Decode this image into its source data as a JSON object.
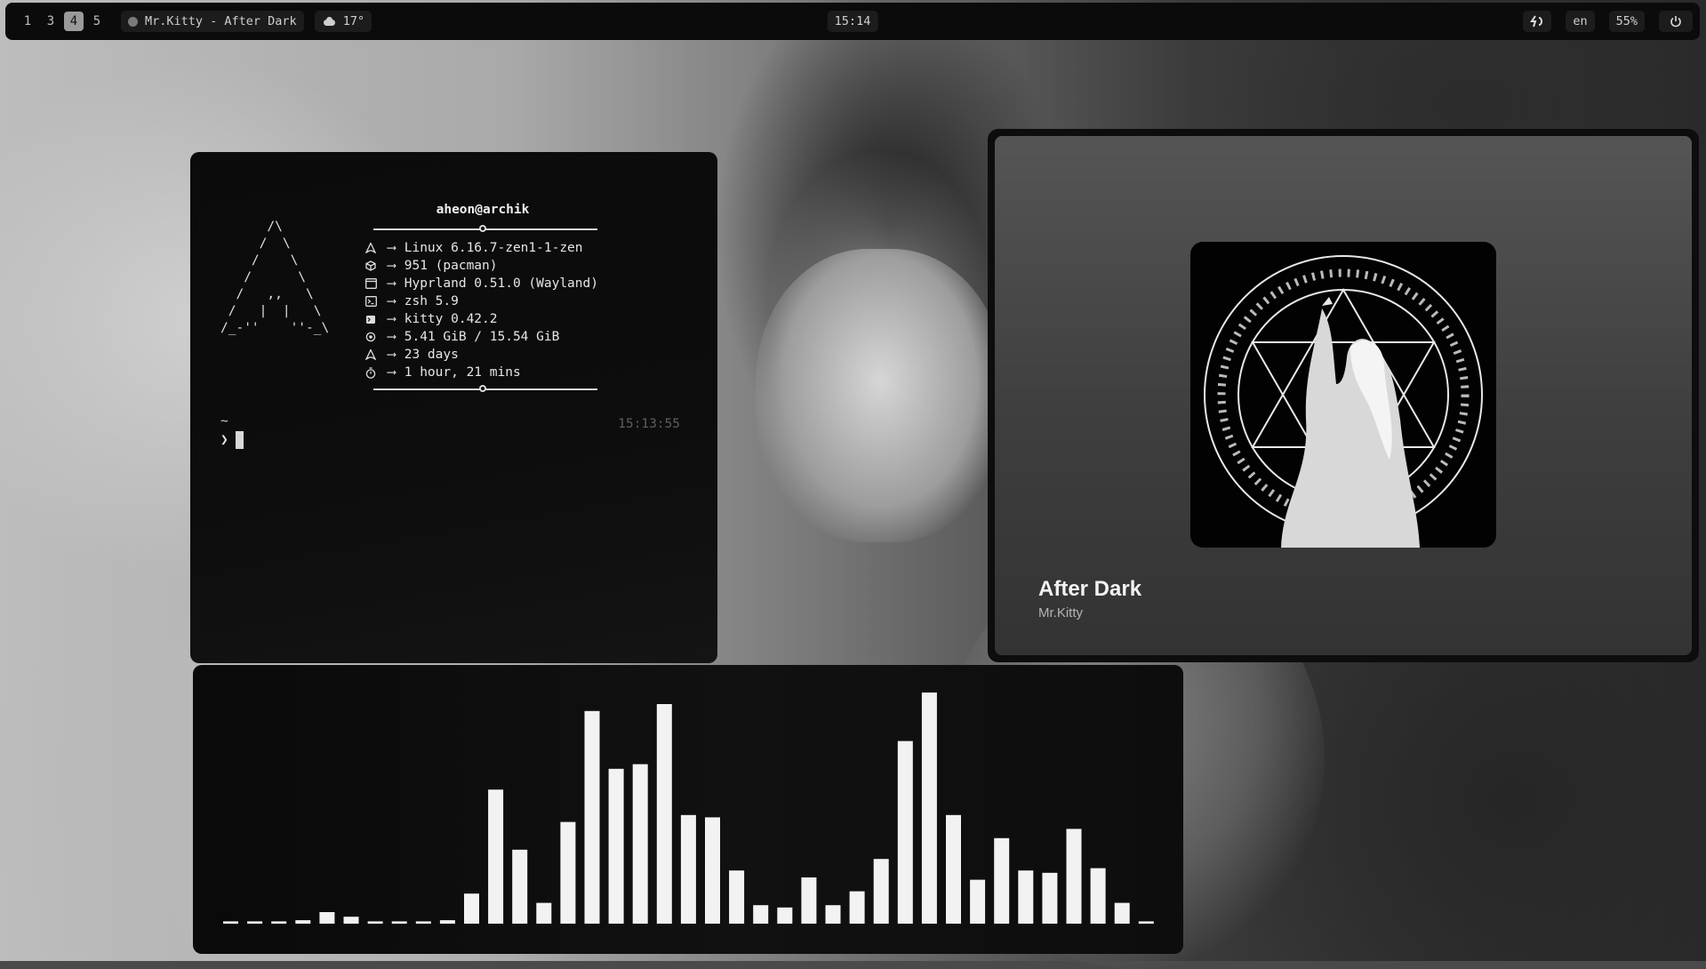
{
  "topbar": {
    "workspaces": [
      {
        "label": "1",
        "active": false
      },
      {
        "label": "3",
        "active": false
      },
      {
        "label": "4",
        "active": true
      },
      {
        "label": "5",
        "active": false
      }
    ],
    "now_playing": "Mr.Kitty - After Dark",
    "weather": "17°",
    "clock": "15:14",
    "language": "en",
    "battery": "55%"
  },
  "terminal": {
    "user_host": "aheon@archik",
    "ascii_logo": "      /\\\n     /  \\\n    /    \\\n   /      \\\n  /   ,,   \\\n /   |  |   \\\n/_-''    ''-_\\",
    "info": [
      {
        "icon": "arch-icon",
        "text": "Linux 6.16.7-zen1-1-zen"
      },
      {
        "icon": "package-icon",
        "text": "951 (pacman)"
      },
      {
        "icon": "window-icon",
        "text": "Hyprland 0.51.0 (Wayland)"
      },
      {
        "icon": "terminal-icon",
        "text": "zsh 5.9"
      },
      {
        "icon": "kitty-icon",
        "text": "kitty 0.42.2"
      },
      {
        "icon": "memory-icon",
        "text": "5.41 GiB / 15.54 GiB"
      },
      {
        "icon": "arch-icon",
        "text": "23 days"
      },
      {
        "icon": "timer-icon",
        "text": "1 hour, 21 mins"
      }
    ],
    "arrow": "⟶",
    "time": "15:13:55",
    "prompt_dir": "~",
    "prompt_symbol": "❯"
  },
  "player": {
    "title": "After Dark",
    "artist": "Mr.Kitty"
  },
  "visualizer": {
    "levels": [
      0.01,
      0.01,
      0.01,
      0.015,
      0.05,
      0.03,
      0.01,
      0.01,
      0.01,
      0.015,
      0.13,
      0.58,
      0.32,
      0.09,
      0.44,
      0.92,
      0.67,
      0.69,
      0.95,
      0.47,
      0.46,
      0.23,
      0.08,
      0.07,
      0.2,
      0.08,
      0.14,
      0.28,
      0.79,
      1.0,
      0.47,
      0.19,
      0.37,
      0.23,
      0.22,
      0.41,
      0.24,
      0.09,
      0.01
    ],
    "bar_color": "#f2f2f2"
  }
}
